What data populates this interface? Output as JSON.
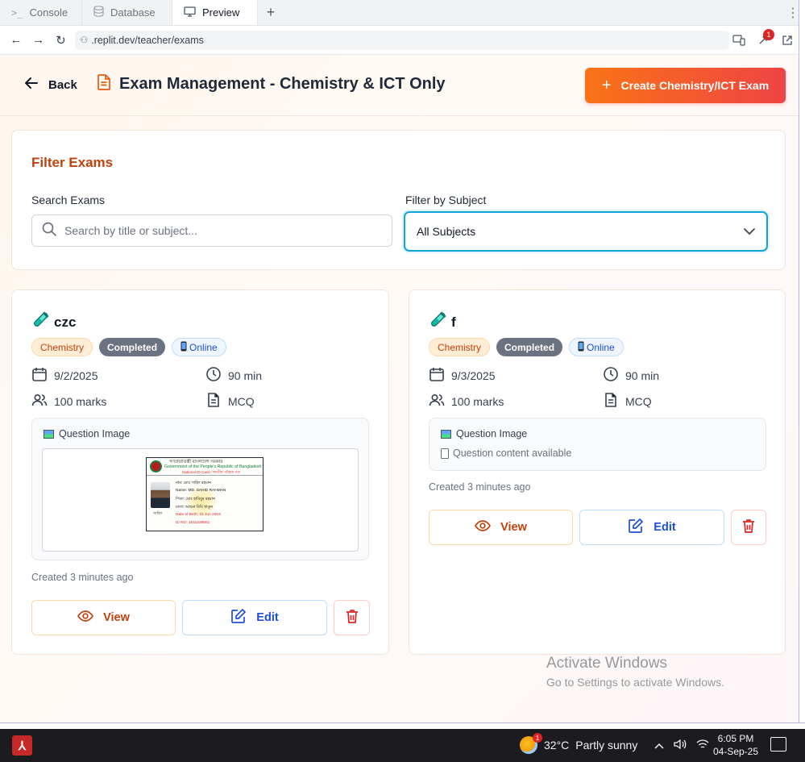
{
  "browser": {
    "tabs": [
      {
        "label": "Console",
        "icon": "terminal-icon"
      },
      {
        "label": "Database",
        "icon": "database-icon"
      },
      {
        "label": "Preview",
        "icon": "monitor-icon",
        "active": true
      }
    ],
    "url": ".replit.dev/teacher/exams",
    "notification_count": "1"
  },
  "header": {
    "back_label": "Back",
    "title": "Exam Management - Chemistry & ICT Only",
    "create_button": "Create Chemistry/ICT Exam"
  },
  "filter": {
    "title": "Filter Exams",
    "search_label": "Search Exams",
    "search_placeholder": "Search by title or subject...",
    "subject_label": "Filter by Subject",
    "subject_selected": "All Subjects"
  },
  "exams": [
    {
      "title": "czc",
      "subject": "Chemistry",
      "status": "Completed",
      "mode": "Online",
      "date": "9/2/2025",
      "duration": "90 min",
      "marks": "100 marks",
      "type": "MCQ",
      "question_label": "Question Image",
      "has_image": true,
      "created": "Created 3 minutes ago",
      "view_label": "View",
      "edit_label": "Edit"
    },
    {
      "title": "f",
      "subject": "Chemistry",
      "status": "Completed",
      "mode": "Online",
      "date": "9/3/2025",
      "duration": "90 min",
      "marks": "100 marks",
      "type": "MCQ",
      "question_label": "Question Image",
      "question_content": "Question content available",
      "has_image": false,
      "created": "Created 3 minutes ago",
      "view_label": "View",
      "edit_label": "Edit"
    }
  ],
  "id_card": {
    "header_bn": "গণপ্রজাতন্ত্রী বাংলাদেশ সরকার",
    "header_en": "Government of the People's Republic of Bangladesh",
    "header_sub": "National ID Card / জাতীয় পরিচয় পত্র",
    "name_bn": "নাম: মোঃ সাহিদ রহমান",
    "name_en": "Name: MD. SAHID RAHMAN",
    "father": "পিতা: মোঃ হাবিবুর রহমান",
    "mother": "মাতা: আছমা বিবি খাতুন",
    "dob": "Date of Birth: 16 Jun 2003",
    "id_no": "ID NO: 1611228661",
    "signature": "সাহিদ"
  },
  "watermark": {
    "line1": "Activate Windows",
    "line2": "Go to Settings to activate Windows."
  },
  "taskbar": {
    "temperature": "32°C",
    "weather": "Partly sunny",
    "weather_badge": "1",
    "time": "6:05 PM",
    "date": "04-Sep-25"
  },
  "colors": {
    "accent_orange": "#f97316",
    "accent_red": "#ef4444",
    "filter_title": "#c2410c",
    "select_focus": "#0ea5d8",
    "status_badge": "#6b7280"
  }
}
